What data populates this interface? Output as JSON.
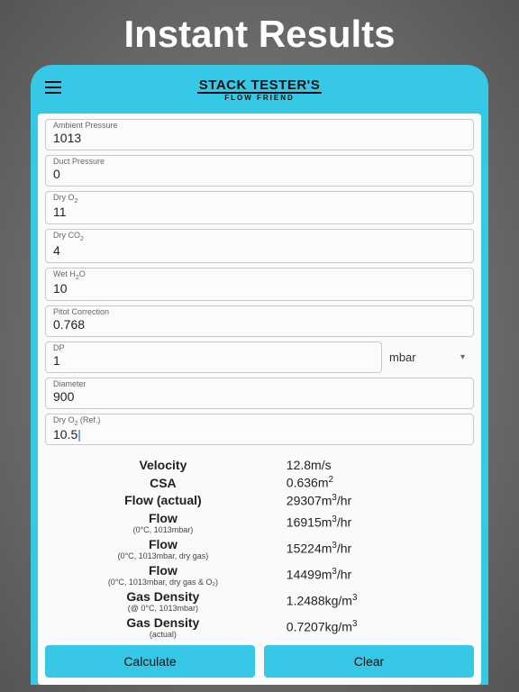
{
  "banner": "Instant Results",
  "logo": {
    "title": "STACK TESTER'S",
    "subtitle": "FLOW FRIEND"
  },
  "fields": {
    "ambient_pressure": {
      "label": "Ambient Pressure",
      "value": "1013"
    },
    "duct_pressure": {
      "label": "Duct Pressure",
      "value": "0"
    },
    "dry_o2": {
      "label_pre": "Dry O",
      "label_sub": "2",
      "value": "11"
    },
    "dry_co2": {
      "label_pre": "Dry CO",
      "label_sub": "2",
      "value": "4"
    },
    "wet_h2o": {
      "label_pre": "Wet H",
      "label_sub": "2",
      "label_post": "O",
      "value": "10"
    },
    "pitot": {
      "label": "Pitot Correction",
      "value": "0.768"
    },
    "dp": {
      "label": "DP",
      "value": "1",
      "unit": "mbar"
    },
    "diameter": {
      "label": "Diameter",
      "value": "900"
    },
    "dry_o2_ref": {
      "label_pre": "Dry O",
      "label_sub": "2",
      "label_post": " (Ref.)",
      "value": "10.5"
    }
  },
  "results": {
    "velocity": {
      "label": "Velocity",
      "value": "12.8m/s"
    },
    "csa": {
      "label": "CSA",
      "value_pre": "0.636m",
      "sup": "2"
    },
    "flow_act": {
      "label": "Flow (actual)",
      "value_pre": "29307m",
      "sup": "3",
      "value_post": "/hr"
    },
    "flow_std": {
      "label": "Flow",
      "sub": "(0°C, 1013mbar)",
      "value_pre": "16915m",
      "sup": "3",
      "value_post": "/hr"
    },
    "flow_dry": {
      "label": "Flow",
      "sub": "(0°C, 1013mbar, dry gas)",
      "value_pre": "15224m",
      "sup": "3",
      "value_post": "/hr"
    },
    "flow_dry_o2": {
      "label": "Flow",
      "sub": "(0°C, 1013mbar, dry gas & O₂)",
      "value_pre": "14499m",
      "sup": "3",
      "value_post": "/hr"
    },
    "gd_std": {
      "label": "Gas Density",
      "sub": "(@ 0°C, 1013mbar)",
      "value_pre": "1.2488kg/m",
      "sup": "3"
    },
    "gd_act": {
      "label": "Gas Density",
      "sub": "(actual)",
      "value_pre": "0.7207kg/m",
      "sup": "3"
    }
  },
  "buttons": {
    "calculate": "Calculate",
    "clear": "Clear"
  }
}
